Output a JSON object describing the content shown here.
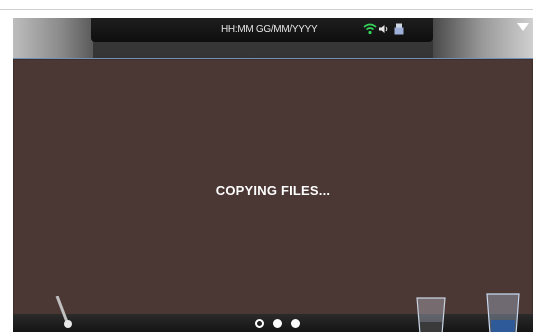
{
  "status_bar": {
    "datetime": "HH:MM GG/MM/YYYY",
    "icons": [
      "wifi-icon",
      "speaker-icon",
      "usb-icon"
    ]
  },
  "dialog": {
    "message": "COPYING FILES..."
  },
  "pagination": {
    "total": 3,
    "active_index": 1
  },
  "colors": {
    "dialog_bg": "#4b3734",
    "dialog_border": "#6f8fb5",
    "wifi": "#35d35a",
    "text": "#ffffff"
  }
}
